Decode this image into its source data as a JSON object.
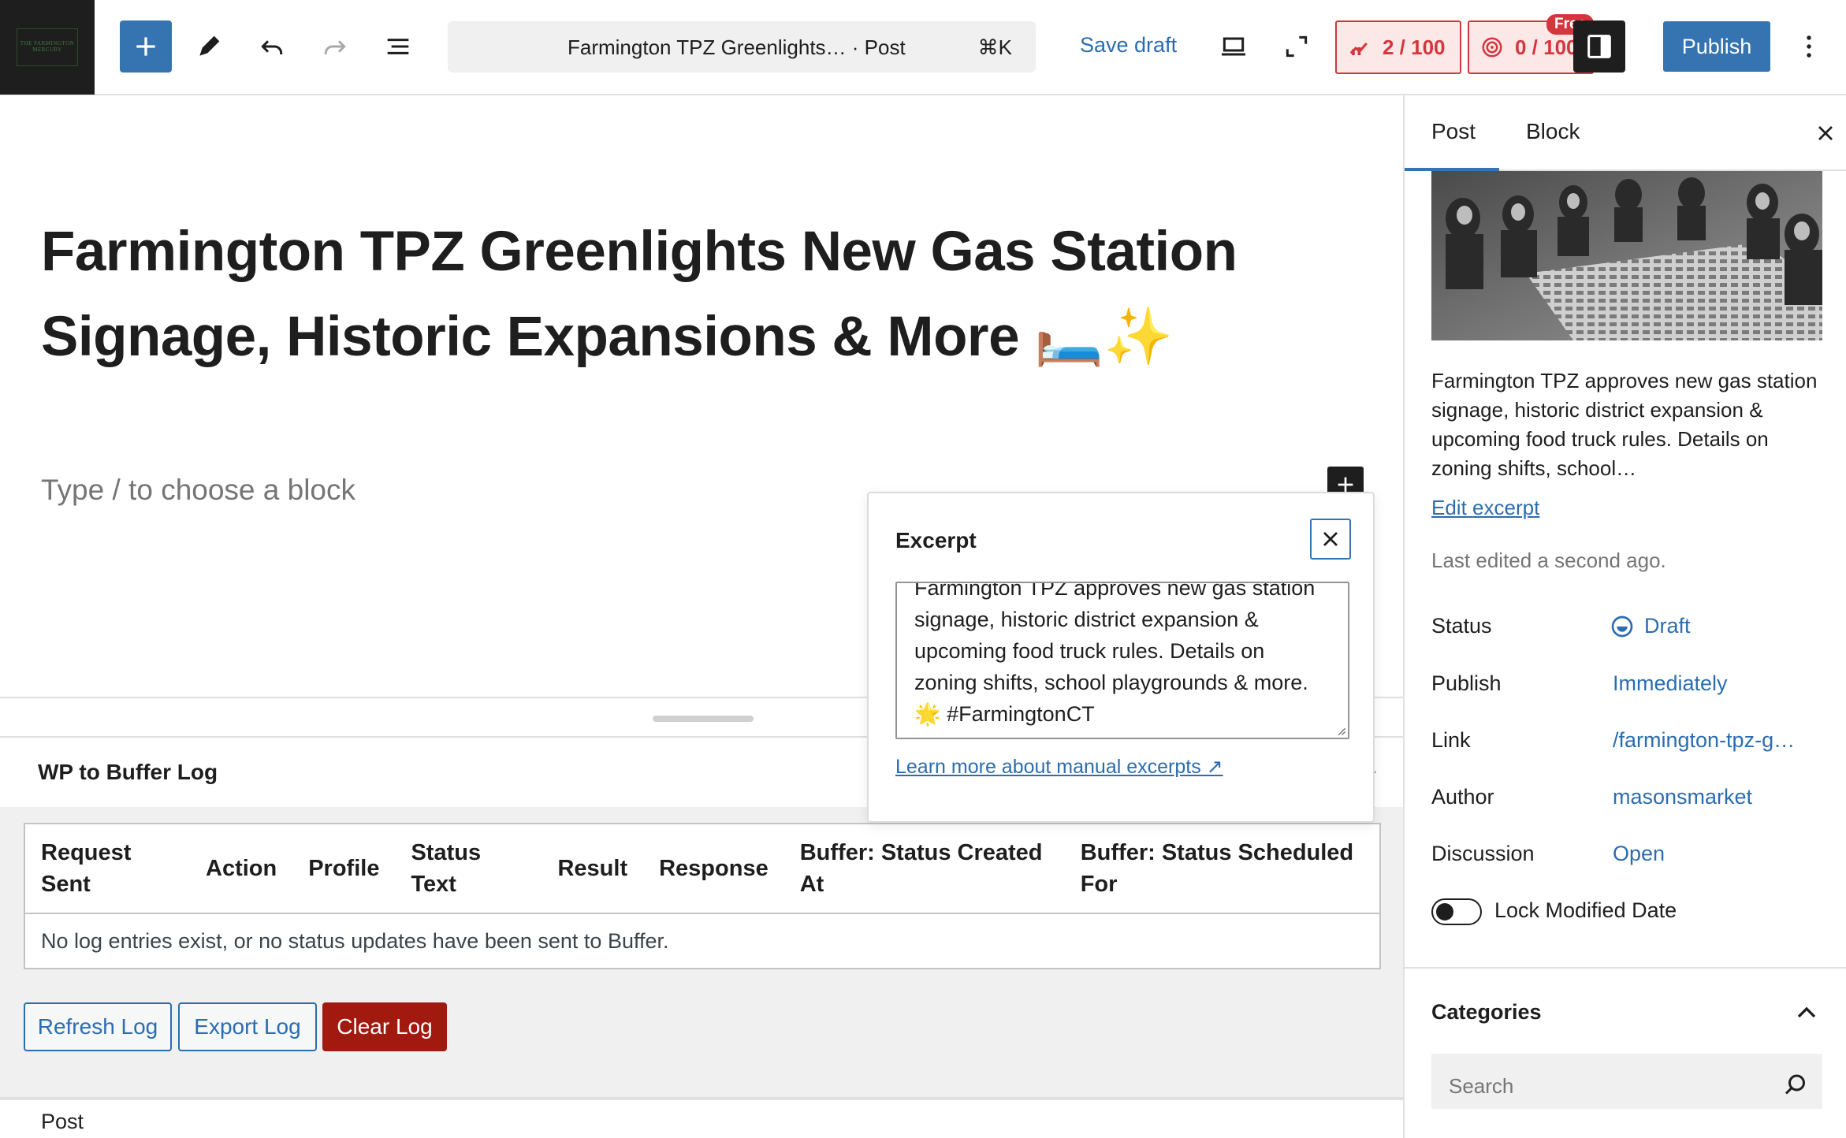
{
  "toolbar": {
    "site_logo_text": "THE FARMINGTON MERCURY",
    "command_title": "Farmington TPZ Greenlights…  · Post",
    "command_shortcut": "⌘K",
    "save_draft": "Save draft",
    "seo_score": "2 / 100",
    "readability_score": "0 / 100",
    "free_tag": "Free",
    "publish": "Publish"
  },
  "editor": {
    "title": "Farmington TPZ Greenlights New Gas Station Signage, Historic Expansions & More 🛏️✨",
    "placeholder": "Type / to choose a block"
  },
  "metabox": {
    "title": "WP to Buffer Log",
    "columns": [
      "Request Sent",
      "Action",
      "Profile",
      "Status Text",
      "Result",
      "Response",
      "Buffer: Status Created At",
      "Buffer: Status Scheduled For"
    ],
    "empty_message": "No log entries exist, or no status updates have been sent to Buffer.",
    "buttons": {
      "refresh": "Refresh Log",
      "export": "Export Log",
      "clear": "Clear Log"
    }
  },
  "status_bar": {
    "label": "Post"
  },
  "excerpt_popover": {
    "title": "Excerpt",
    "text": "Farmington TPZ approves new gas station signage, historic district expansion & upcoming food truck rules. Details on zoning shifts, school playgrounds & more. 🌟 #FarmingtonCT",
    "learn_more": "Learn more about manual excerpts ↗"
  },
  "sidebar": {
    "tabs": [
      "Post",
      "Block"
    ],
    "active_tab": "Post",
    "excerpt_preview": "Farmington TPZ approves new gas station signage, historic district expansion & upcoming food truck rules. Details on zoning shifts, school…",
    "edit_excerpt": "Edit excerpt",
    "last_edited": "Last edited a second ago.",
    "properties": {
      "status_label": "Status",
      "status_value": "Draft",
      "publish_label": "Publish",
      "publish_value": "Immediately",
      "link_label": "Link",
      "link_value": "/farmington-tpz-g…",
      "author_label": "Author",
      "author_value": "masonsmarket",
      "discussion_label": "Discussion",
      "discussion_value": "Open"
    },
    "lock_modified_date": "Lock Modified Date",
    "lock_modified_enabled": false,
    "categories_title": "Categories",
    "categories_search_placeholder": "Search"
  },
  "colors": {
    "accent": "#3573b1",
    "link": "#2b6db0",
    "danger": "#a2190f",
    "badge_red": "#d5353c"
  }
}
